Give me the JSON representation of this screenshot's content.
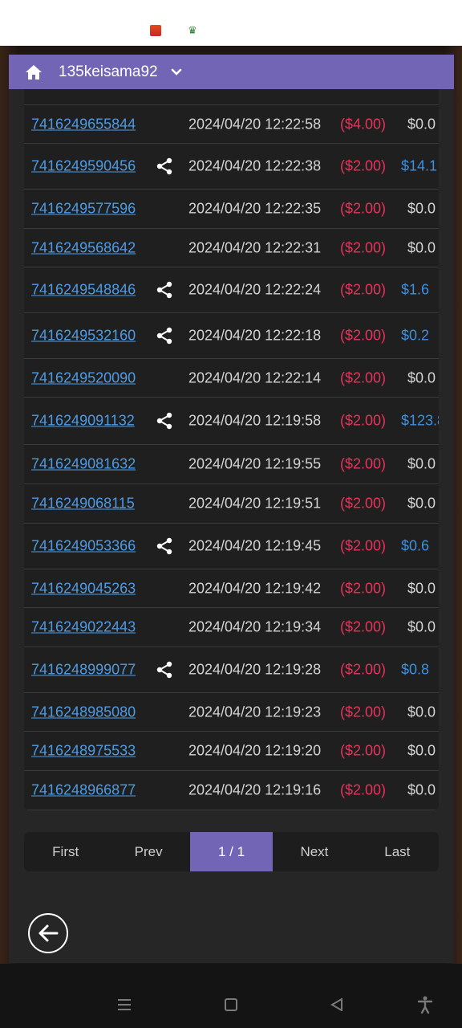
{
  "header": {
    "title": "135keisama92"
  },
  "rows": [
    {
      "id": "7416249655844",
      "share": false,
      "time": "2024/04/20 12:22:58",
      "bet": "($4.00)",
      "win": "$0.0",
      "win_type": "zero"
    },
    {
      "id": "7416249590456",
      "share": true,
      "time": "2024/04/20 12:22:38",
      "bet": "($2.00)",
      "win": "$14.1",
      "win_type": "pos"
    },
    {
      "id": "7416249577596",
      "share": false,
      "time": "2024/04/20 12:22:35",
      "bet": "($2.00)",
      "win": "$0.0",
      "win_type": "zero"
    },
    {
      "id": "7416249568642",
      "share": false,
      "time": "2024/04/20 12:22:31",
      "bet": "($2.00)",
      "win": "$0.0",
      "win_type": "zero"
    },
    {
      "id": "7416249548846",
      "share": true,
      "time": "2024/04/20 12:22:24",
      "bet": "($2.00)",
      "win": "$1.6",
      "win_type": "pos"
    },
    {
      "id": "7416249532160",
      "share": true,
      "time": "2024/04/20 12:22:18",
      "bet": "($2.00)",
      "win": "$0.2",
      "win_type": "pos"
    },
    {
      "id": "7416249520090",
      "share": false,
      "time": "2024/04/20 12:22:14",
      "bet": "($2.00)",
      "win": "$0.0",
      "win_type": "zero"
    },
    {
      "id": "7416249091132",
      "share": true,
      "time": "2024/04/20 12:19:58",
      "bet": "($2.00)",
      "win": "$123.8",
      "win_type": "pos"
    },
    {
      "id": "7416249081632",
      "share": false,
      "time": "2024/04/20 12:19:55",
      "bet": "($2.00)",
      "win": "$0.0",
      "win_type": "zero"
    },
    {
      "id": "7416249068115",
      "share": false,
      "time": "2024/04/20 12:19:51",
      "bet": "($2.00)",
      "win": "$0.0",
      "win_type": "zero"
    },
    {
      "id": "7416249053366",
      "share": true,
      "time": "2024/04/20 12:19:45",
      "bet": "($2.00)",
      "win": "$0.6",
      "win_type": "pos"
    },
    {
      "id": "7416249045263",
      "share": false,
      "time": "2024/04/20 12:19:42",
      "bet": "($2.00)",
      "win": "$0.0",
      "win_type": "zero"
    },
    {
      "id": "7416249022443",
      "share": false,
      "time": "2024/04/20 12:19:34",
      "bet": "($2.00)",
      "win": "$0.0",
      "win_type": "zero"
    },
    {
      "id": "7416248999077",
      "share": true,
      "time": "2024/04/20 12:19:28",
      "bet": "($2.00)",
      "win": "$0.8",
      "win_type": "pos"
    },
    {
      "id": "7416248985080",
      "share": false,
      "time": "2024/04/20 12:19:23",
      "bet": "($2.00)",
      "win": "$0.0",
      "win_type": "zero"
    },
    {
      "id": "7416248975533",
      "share": false,
      "time": "2024/04/20 12:19:20",
      "bet": "($2.00)",
      "win": "$0.0",
      "win_type": "zero"
    },
    {
      "id": "7416248966877",
      "share": false,
      "time": "2024/04/20 12:19:16",
      "bet": "($2.00)",
      "win": "$0.0",
      "win_type": "zero"
    }
  ],
  "pager": {
    "first": "First",
    "prev": "Prev",
    "current": "1 / 1",
    "next": "Next",
    "last": "Last"
  },
  "colors": {
    "accent": "#7265b5",
    "link": "#4d9be6",
    "negative": "#e8335a",
    "positive": "#3d8fe0"
  }
}
